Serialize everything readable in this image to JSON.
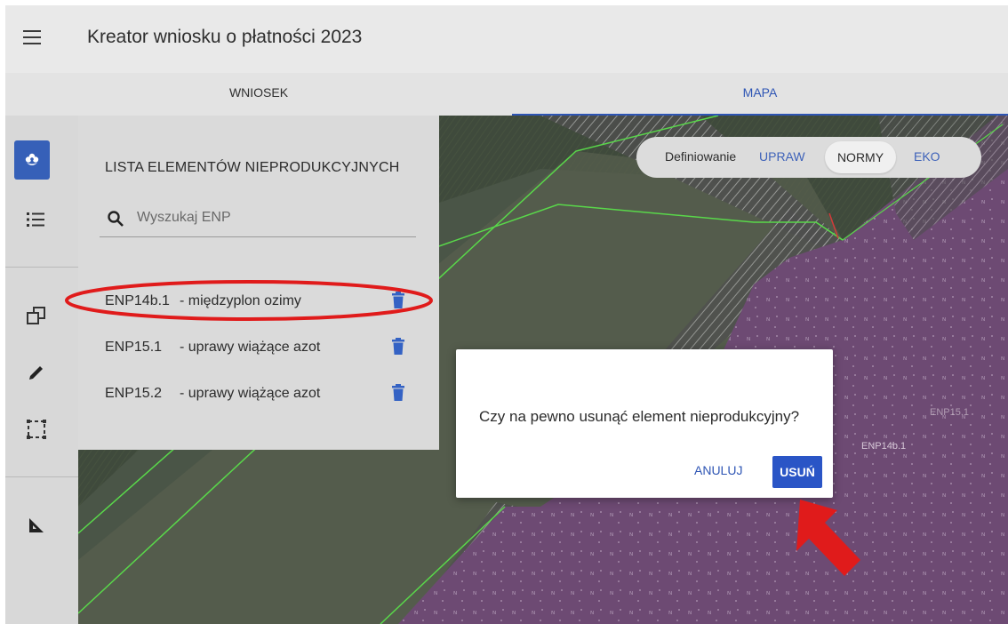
{
  "header": {
    "title": "Kreator wniosku o płatności 2023"
  },
  "tabs": [
    {
      "label": "WNIOSEK"
    },
    {
      "label": "MAPA"
    }
  ],
  "toolbar": {
    "buttons": [
      {
        "icon": "flower-icon"
      },
      {
        "icon": "list-icon"
      },
      {
        "icon": "copy-icon"
      },
      {
        "icon": "pencil-icon"
      },
      {
        "icon": "select-area-icon"
      },
      {
        "icon": "ruler-icon"
      }
    ]
  },
  "panel": {
    "title": "LISTA ELEMENTÓW NIEPRODUKCYJNYCH",
    "search_placeholder": "Wyszukaj ENP",
    "items": [
      {
        "code": "ENP14b.1",
        "desc": "- międzyplon ozimy"
      },
      {
        "code": "ENP15.1",
        "desc": "- uprawy wiążące azot"
      },
      {
        "code": "ENP15.2",
        "desc": "- uprawy wiążące azot"
      }
    ]
  },
  "mode": {
    "label": "Definiowanie",
    "options": [
      "UPRAW",
      "NORMY",
      "EKO"
    ],
    "selected": "NORMY"
  },
  "dialog": {
    "message": "Czy na pewno usunąć element nieprodukcyjny?",
    "cancel_label": "ANULUJ",
    "confirm_label": "USUŃ"
  },
  "map": {
    "labels": [
      "ENP14b.1",
      "ENP15.1"
    ]
  },
  "colors": {
    "accent": "#2e55b4",
    "annotation": "#e01b1b",
    "parcel_fill": "#7a4f80"
  }
}
